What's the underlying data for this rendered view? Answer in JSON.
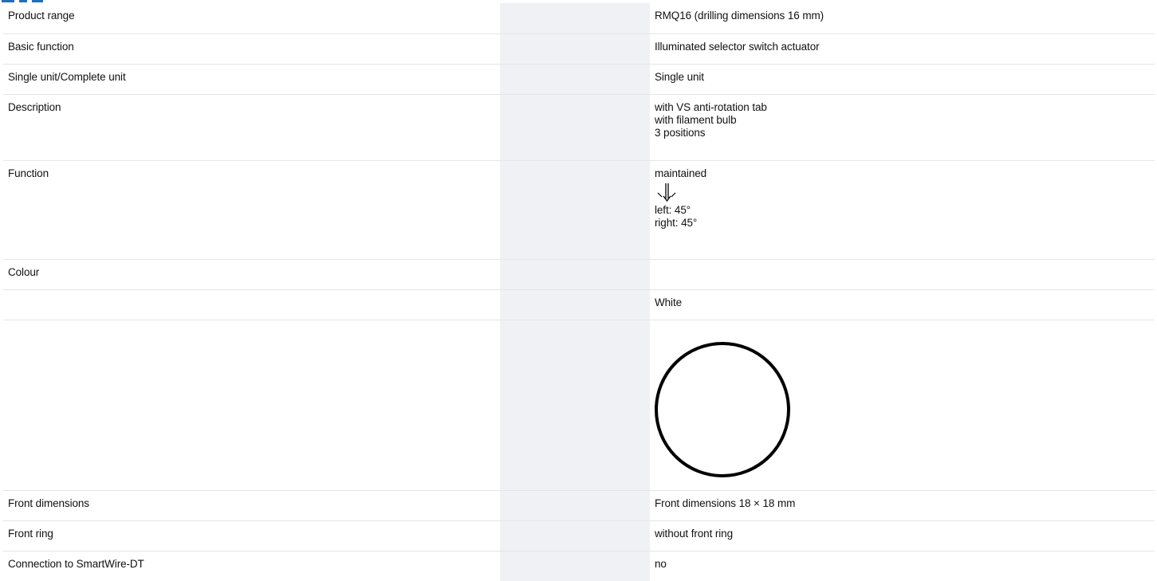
{
  "specs": {
    "rows": [
      {
        "label": "Product range",
        "value": "RMQ16 (drilling dimensions 16 mm)"
      },
      {
        "label": "Basic function",
        "value": "Illuminated selector switch actuator"
      },
      {
        "label": "Single unit/Complete unit",
        "value": "Single unit"
      },
      {
        "label": "Description",
        "value_lines": [
          "with VS anti-rotation tab",
          "with filament bulb",
          "3 positions"
        ]
      },
      {
        "label": "Function",
        "value_top": "maintained",
        "symbol": "switch-rotation-symbol-icon",
        "value_lines": [
          "left: 45°",
          "right: 45°"
        ]
      },
      {
        "label": "Colour",
        "value": ""
      },
      {
        "label": "",
        "value": "White"
      },
      {
        "label": "",
        "symbol": "white-colour-circle-icon"
      },
      {
        "label": "Front dimensions",
        "value": "Front dimensions 18 × 18 mm"
      },
      {
        "label": "Front ring",
        "value": "without front ring"
      },
      {
        "label": "Connection to SmartWire-DT",
        "value": "no"
      }
    ]
  },
  "colors": {
    "grey_column": "#eff1f5",
    "row_divider": "#e3e5e9",
    "accent_blue": "#1f6fbf",
    "circle_stroke": "#000000"
  }
}
